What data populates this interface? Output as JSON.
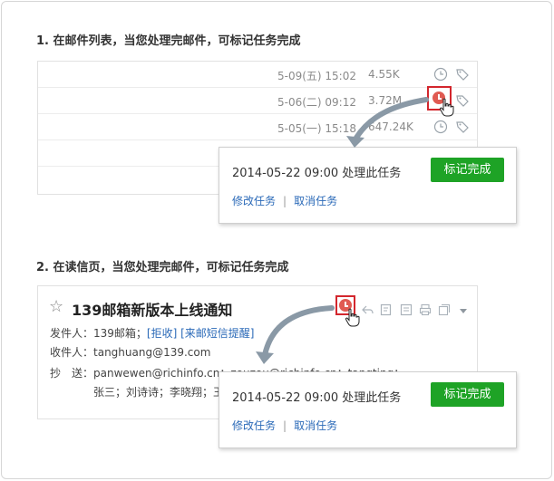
{
  "section1": {
    "heading": "1. 在邮件列表，当您处理完邮件，可标记任务完成",
    "rows": [
      {
        "date": "5-09(五) 15:02",
        "size": "4.55K"
      },
      {
        "date": "5-06(二) 09:12",
        "size": "3.72M"
      },
      {
        "date": "5-05(一) 15:18",
        "size": "647.24K"
      }
    ],
    "popup": {
      "text": "2014-05-22 09:00 处理此任务",
      "button": "标记完成",
      "link_edit": "修改任务",
      "link_sep": "|",
      "link_cancel": "取消任务"
    }
  },
  "section2": {
    "heading": "2. 在读信页，当您处理完邮件，可标记任务完成",
    "star": "☆",
    "subject": "139邮箱新版本上线通知",
    "sender_label": "发件人：",
    "sender_name": "139邮箱；",
    "reject_link": "[拒收]",
    "sms_link": "[来邮短信提醒]",
    "recipient_label": "收件人：",
    "recipient": "tanghuang@139.com",
    "cc_label": "抄　送：",
    "cc_line1": "panwewen@richinfo.cn；zouzou@richinfo.cn；tangting；",
    "cc_line2": "张三；刘诗诗；李晓翔；王",
    "popup": {
      "text": "2014-05-22 09:00 处理此任务",
      "button": "标记完成",
      "link_edit": "修改任务",
      "link_sep": "|",
      "link_cancel": "取消任务"
    }
  },
  "colors": {
    "accent_green": "#1ea326",
    "highlight_red": "#d3262d",
    "link_blue": "#2b6ab8",
    "arrow_gray": "#8a99a6"
  },
  "icons": [
    "clock-icon",
    "tag-icon",
    "hand-cursor-icon",
    "reply-icon",
    "edit-icon",
    "print-icon",
    "window-icon",
    "chevron-down-icon",
    "star-icon"
  ]
}
